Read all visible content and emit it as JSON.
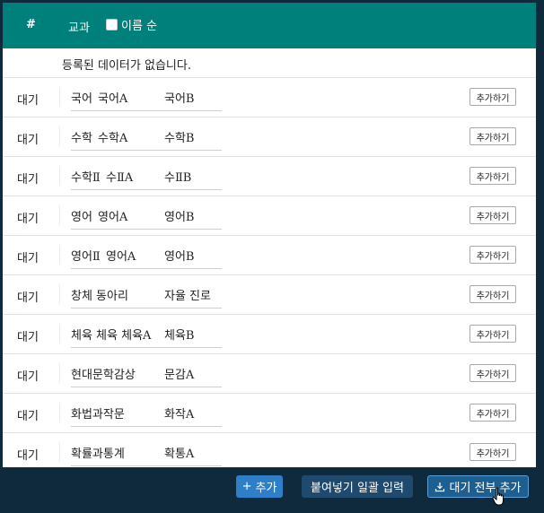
{
  "header": {
    "hash": "#",
    "subject": "교과",
    "sort_label": "이름 순"
  },
  "empty_message": "등록된 데이터가 없습니다.",
  "rows": [
    {
      "status": "대기",
      "name": "국어",
      "short": "국어A",
      "code": "국어B",
      "button": "추가하기"
    },
    {
      "status": "대기",
      "name": "수학",
      "short": "수학A",
      "code": "수학B",
      "button": "추가하기"
    },
    {
      "status": "대기",
      "name": "수학Ⅱ",
      "short": "수ⅡA",
      "code": "수ⅡB",
      "button": "추가하기"
    },
    {
      "status": "대기",
      "name": "영어",
      "short": "영어A",
      "code": "영어B",
      "button": "추가하기"
    },
    {
      "status": "대기",
      "name": "영어Ⅱ",
      "short": "영어A",
      "code": "영어B",
      "button": "추가하기"
    },
    {
      "status": "대기",
      "name": "창체 동아리",
      "short": "",
      "code": "자율 진로",
      "button": "추가하기"
    },
    {
      "status": "대기",
      "name": "체육 체육 체육A",
      "short": "",
      "code": "체육B",
      "button": "추가하기"
    },
    {
      "status": "대기",
      "name": "현대문학감상",
      "short": "",
      "code": "문감A",
      "button": "추가하기"
    },
    {
      "status": "대기",
      "name": "화법과작문",
      "short": "",
      "code": "화작A",
      "button": "추가하기"
    },
    {
      "status": "대기",
      "name": "확률과통계",
      "short": "",
      "code": "확통A",
      "button": "추가하기"
    }
  ],
  "footer": {
    "add_label": "추가",
    "paste_label": "붙여넣기 일괄 입력",
    "add_all_label": "대기 전부 추가"
  }
}
